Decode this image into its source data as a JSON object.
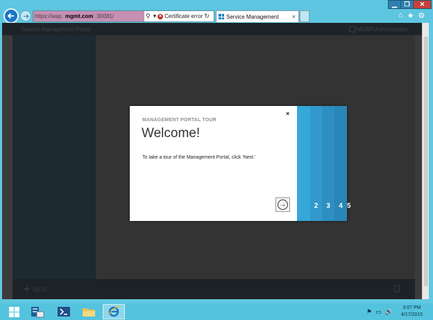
{
  "browser": {
    "address": {
      "url_prefix": "https://wap.",
      "url_domain": "mgmt.com",
      "url_suffix": ":30081/",
      "search_glyph": "⚲",
      "dropdown_glyph": "▾",
      "refresh_glyph": "↻"
    },
    "cert_error": "Certificate error",
    "tab": {
      "label": "Service Management",
      "close": "×"
    },
    "window_controls": {
      "minimize": "▁",
      "maximize": "❐",
      "close": "✕"
    },
    "toolbar": {
      "home": "⌂",
      "favorites": "★",
      "tools": "⚙"
    }
  },
  "portal": {
    "title": "Service Management Portal",
    "user": "MGMT\\Administrator",
    "footer_new": "NEW",
    "footer_plus": "+"
  },
  "dialog": {
    "eyebrow": "MANAGEMENT PORTAL TOUR",
    "title": "Welcome!",
    "body": "To take a tour of the Management Portal, click 'Next.'",
    "close": "×",
    "next_glyph": "→",
    "steps": [
      {
        "num": "",
        "color": "#35a8d8"
      },
      {
        "num": "2",
        "color": "#3399cc"
      },
      {
        "num": "3",
        "color": "#2d8fc0"
      },
      {
        "num": "4",
        "color": "#2a86b6"
      },
      {
        "num": "5",
        "color": "#267cab"
      }
    ]
  },
  "taskbar": {
    "clock_time": "3:07 PM",
    "clock_date": "4/17/2015",
    "tray": [
      "⚑",
      "▭",
      "🔊"
    ]
  },
  "colors": {
    "chrome": "#5ec6e0",
    "portal_sidebar": "#1e2a31",
    "accent": "#1d7fc2"
  }
}
